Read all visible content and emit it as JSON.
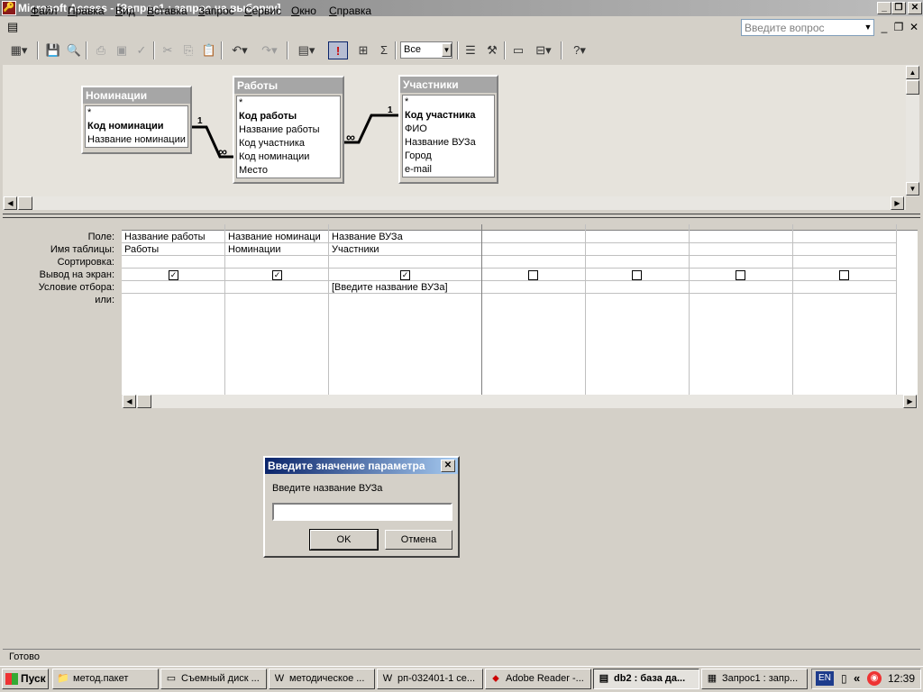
{
  "window": {
    "title": "Microsoft Access - [Запрос1 : запрос на выборку]",
    "app_icon": "access-key-icon"
  },
  "menu": [
    "Файл",
    "Правка",
    "Вид",
    "Вставка",
    "Запрос",
    "Сервис",
    "Окно",
    "Справка"
  ],
  "help_box": {
    "placeholder": "Введите вопрос"
  },
  "toolbar": {
    "top_values": "Все"
  },
  "tables": [
    {
      "name": "Номинации",
      "fields": [
        "*",
        "Код номинации",
        "Название номинации"
      ],
      "key": "Код номинации"
    },
    {
      "name": "Работы",
      "fields": [
        "*",
        "Код работы",
        "Название работы",
        "Код участника",
        "Код номинации",
        "Место"
      ],
      "key": "Код работы"
    },
    {
      "name": "Участники",
      "fields": [
        "*",
        "Код участника",
        "ФИО",
        "Название ВУЗа",
        "Город",
        "e-mail"
      ],
      "key": "Код участника"
    }
  ],
  "relations": {
    "one": "1",
    "many": "∞"
  },
  "grid": {
    "row_labels": [
      "Поле:",
      "Имя таблицы:",
      "Сортировка:",
      "Вывод на экран:",
      "Условие отбора:",
      "или:"
    ],
    "columns": [
      {
        "field": "Название работы",
        "table": "Работы",
        "sort": "",
        "show": true,
        "criteria": ""
      },
      {
        "field": "Название номинаци",
        "table": "Номинации",
        "sort": "",
        "show": true,
        "criteria": ""
      },
      {
        "field": "Название ВУЗа",
        "table": "Участники",
        "sort": "",
        "show": true,
        "criteria": "[Введите название ВУЗа]"
      },
      {
        "field": "",
        "table": "",
        "sort": "",
        "show": false,
        "criteria": ""
      },
      {
        "field": "",
        "table": "",
        "sort": "",
        "show": false,
        "criteria": ""
      },
      {
        "field": "",
        "table": "",
        "sort": "",
        "show": false,
        "criteria": ""
      },
      {
        "field": "",
        "table": "",
        "sort": "",
        "show": false,
        "criteria": ""
      }
    ]
  },
  "dialog": {
    "title": "Введите значение параметра",
    "prompt": "Введите название ВУЗа",
    "value": "",
    "ok": "OK",
    "cancel": "Отмена"
  },
  "status": "Готово",
  "taskbar": {
    "start": "Пуск",
    "tasks": [
      "метод.пакет",
      "Съемный диск ...",
      "методическое ...",
      "рп-032401-1 се...",
      "Adobe Reader -...",
      "db2 : база да...",
      "Запрос1 : запр..."
    ],
    "active_task": 5,
    "lang": "EN",
    "clock": "12:39"
  }
}
